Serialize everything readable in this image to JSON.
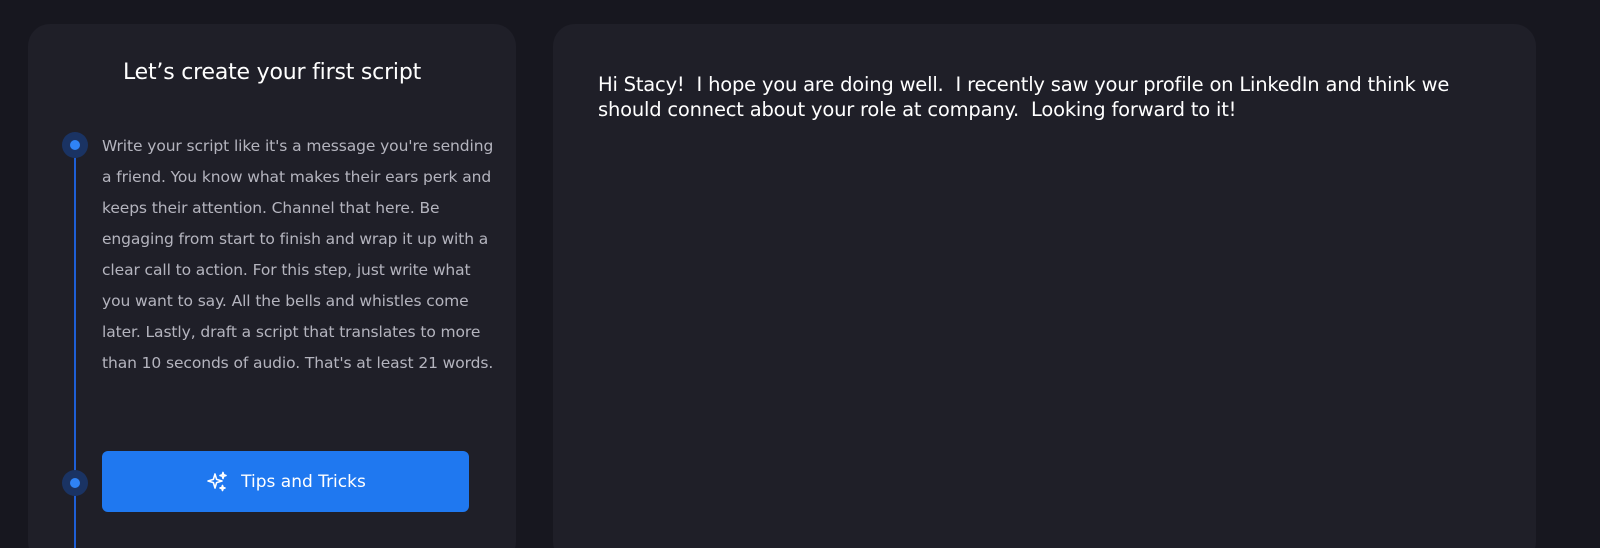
{
  "left_panel": {
    "title": "Let’s create your first script",
    "instructions": "Write your script like it's a message you're sending a friend. You know what makes their ears perk and keeps their attention. Channel that here. Be engaging from start to finish and wrap it up with a clear call to action. For this step, just write what you want to say. All the bells and whistles come later. Lastly, draft a script that translates to more than 10 seconds of audio. That's at least 21 words.",
    "tips_button": {
      "label": "Tips and Tricks",
      "icon": "sparkle-icon"
    }
  },
  "editor": {
    "value": "Hi Stacy!  I hope you are doing well.  I recently saw your profile on LinkedIn and think we should connect about your role at company.  Looking forward to it!"
  },
  "colors": {
    "background": "#17171f",
    "panel": "#1f1f28",
    "accent": "#1f78f0",
    "timeline": "#1e5fd6"
  }
}
